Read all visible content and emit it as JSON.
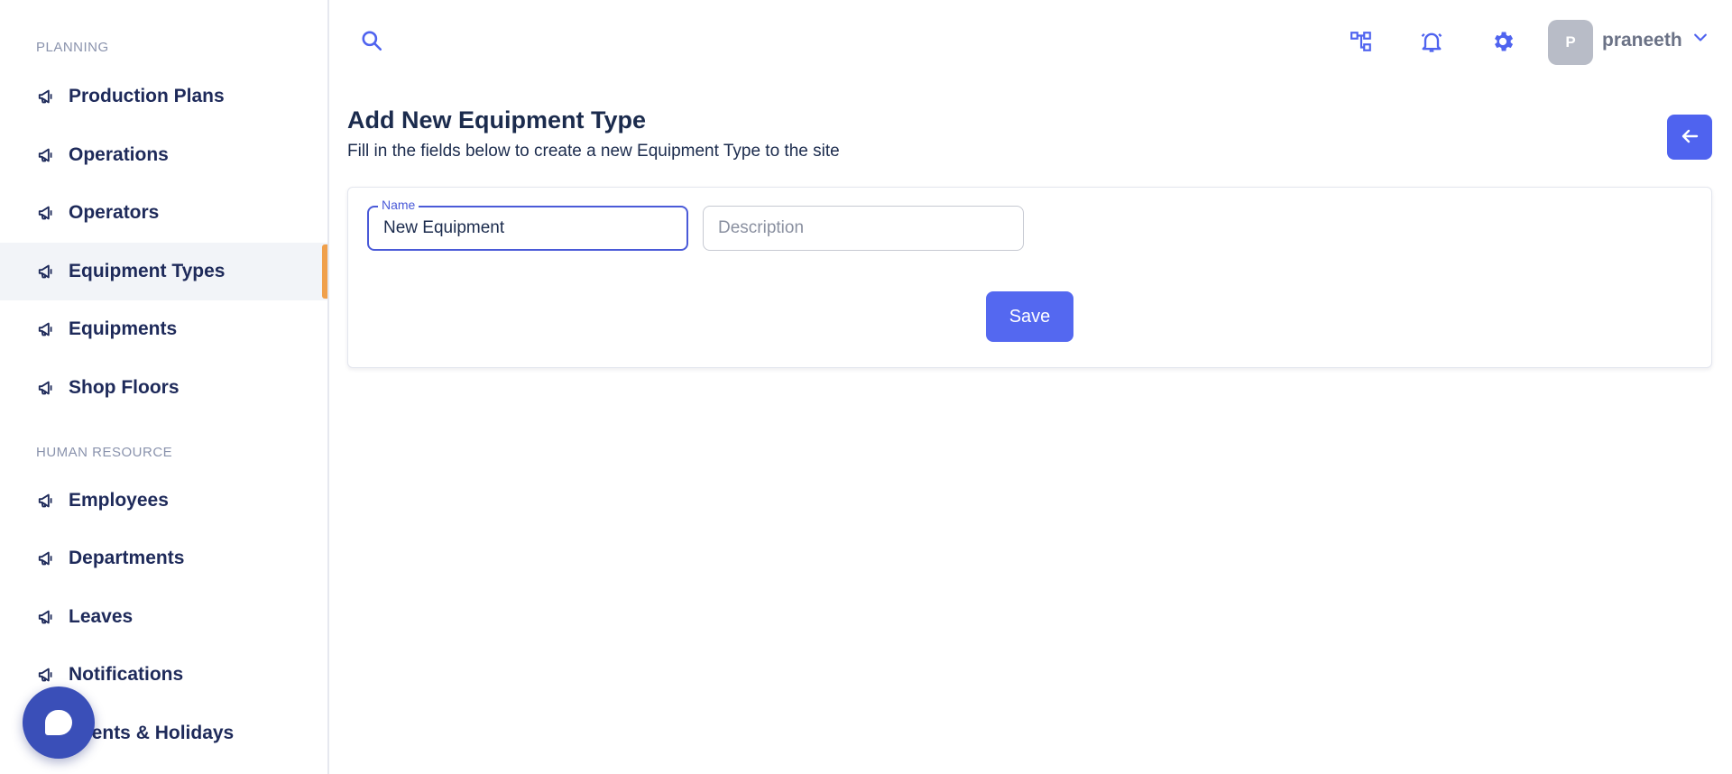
{
  "sidebar": {
    "sections": [
      {
        "title": "PLANNING",
        "items": [
          {
            "label": "Production Plans"
          },
          {
            "label": "Operations"
          },
          {
            "label": "Operators"
          },
          {
            "label": "Equipment Types",
            "active": true
          },
          {
            "label": "Equipments"
          },
          {
            "label": "Shop Floors"
          }
        ]
      },
      {
        "title": "HUMAN RESOURCE",
        "items": [
          {
            "label": "Employees"
          },
          {
            "label": "Departments"
          },
          {
            "label": "Leaves"
          },
          {
            "label": "Notifications"
          },
          {
            "label": "Events & Holidays"
          }
        ]
      }
    ]
  },
  "header": {
    "icons": [
      "search-icon",
      "hierarchy-icon",
      "bell-icon",
      "gear-icon"
    ],
    "user": {
      "initial": "P",
      "name": "praneeth"
    }
  },
  "main": {
    "title": "Add New Equipment Type",
    "subtitle": "Fill in the fields below to create a new Equipment Type to the site",
    "form": {
      "name_label": "Name",
      "name_value": "New Equipment",
      "description_placeholder": "Description",
      "save_label": "Save"
    }
  },
  "colors": {
    "accent": "#5468f0",
    "active_indicator": "#f0a04b",
    "nav_text": "#1e2a5a"
  }
}
